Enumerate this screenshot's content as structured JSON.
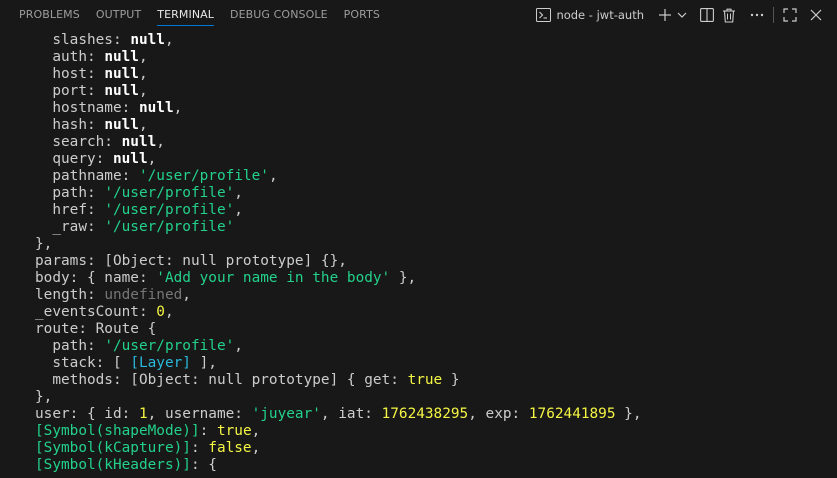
{
  "panel": {
    "tabs": [
      {
        "label": "PROBLEMS",
        "active": false
      },
      {
        "label": "OUTPUT",
        "active": false
      },
      {
        "label": "TERMINAL",
        "active": true
      },
      {
        "label": "DEBUG CONSOLE",
        "active": false
      },
      {
        "label": "PORTS",
        "active": false
      }
    ],
    "terminal_name": "node - jwt-auth",
    "icons": [
      "terminal-icon",
      "new-terminal-icon",
      "chevron-down-icon",
      "split-terminal-icon",
      "trash-icon",
      "more-actions-icon",
      "maximize-panel-icon",
      "close-icon"
    ],
    "colors": {
      "background": "#181818",
      "active_tab_underline": "#0078d4",
      "string": "#23d18b",
      "number": "#f5f543",
      "keyword": "#ffffff",
      "undefined": "#767676",
      "class_ref": "#29b8db"
    }
  },
  "terminal": {
    "lines": [
      [
        {
          "t": "  slashes: "
        },
        {
          "t": "null",
          "c": "n"
        },
        {
          "t": ","
        }
      ],
      [
        {
          "t": "  auth: "
        },
        {
          "t": "null",
          "c": "n"
        },
        {
          "t": ","
        }
      ],
      [
        {
          "t": "  host: "
        },
        {
          "t": "null",
          "c": "n"
        },
        {
          "t": ","
        }
      ],
      [
        {
          "t": "  port: "
        },
        {
          "t": "null",
          "c": "n"
        },
        {
          "t": ","
        }
      ],
      [
        {
          "t": "  hostname: "
        },
        {
          "t": "null",
          "c": "n"
        },
        {
          "t": ","
        }
      ],
      [
        {
          "t": "  hash: "
        },
        {
          "t": "null",
          "c": "n"
        },
        {
          "t": ","
        }
      ],
      [
        {
          "t": "  search: "
        },
        {
          "t": "null",
          "c": "n"
        },
        {
          "t": ","
        }
      ],
      [
        {
          "t": "  query: "
        },
        {
          "t": "null",
          "c": "n"
        },
        {
          "t": ","
        }
      ],
      [
        {
          "t": "  pathname: "
        },
        {
          "t": "'/user/profile'",
          "c": "s"
        },
        {
          "t": ","
        }
      ],
      [
        {
          "t": "  path: "
        },
        {
          "t": "'/user/profile'",
          "c": "s"
        },
        {
          "t": ","
        }
      ],
      [
        {
          "t": "  href: "
        },
        {
          "t": "'/user/profile'",
          "c": "s"
        },
        {
          "t": ","
        }
      ],
      [
        {
          "t": "  _raw: "
        },
        {
          "t": "'/user/profile'",
          "c": "s"
        }
      ],
      [
        {
          "t": "},"
        }
      ],
      [
        {
          "t": "params: [Object: null prototype] {},"
        }
      ],
      [
        {
          "t": "body: { name: "
        },
        {
          "t": "'Add your name in the body'",
          "c": "s"
        },
        {
          "t": " },"
        }
      ],
      [
        {
          "t": "length: "
        },
        {
          "t": "undefined",
          "c": "g"
        },
        {
          "t": ","
        }
      ],
      [
        {
          "t": "_eventsCount: "
        },
        {
          "t": "0",
          "c": "num"
        },
        {
          "t": ","
        }
      ],
      [
        {
          "t": "route: Route {"
        }
      ],
      [
        {
          "t": "  path: "
        },
        {
          "t": "'/user/profile'",
          "c": "s"
        },
        {
          "t": ","
        }
      ],
      [
        {
          "t": "  stack: [ "
        },
        {
          "t": "[Layer]",
          "c": "cls"
        },
        {
          "t": " ],"
        }
      ],
      [
        {
          "t": "  methods: [Object: null prototype] { get: "
        },
        {
          "t": "true",
          "c": "num"
        },
        {
          "t": " }"
        }
      ],
      [
        {
          "t": "},"
        }
      ],
      [
        {
          "t": "user: { id: "
        },
        {
          "t": "1",
          "c": "num"
        },
        {
          "t": ", username: "
        },
        {
          "t": "'juyear'",
          "c": "s"
        },
        {
          "t": ", iat: "
        },
        {
          "t": "1762438295",
          "c": "num"
        },
        {
          "t": ", exp: "
        },
        {
          "t": "1762441895",
          "c": "num"
        },
        {
          "t": " },"
        }
      ],
      [
        {
          "t": "[Symbol(shapeMode)]",
          "c": "sym"
        },
        {
          "t": ": "
        },
        {
          "t": "true",
          "c": "num"
        },
        {
          "t": ","
        }
      ],
      [
        {
          "t": "[Symbol(kCapture)]",
          "c": "sym"
        },
        {
          "t": ": "
        },
        {
          "t": "false",
          "c": "num"
        },
        {
          "t": ","
        }
      ],
      [
        {
          "t": "[Symbol(kHeaders)]",
          "c": "sym"
        },
        {
          "t": ": {"
        }
      ]
    ]
  }
}
